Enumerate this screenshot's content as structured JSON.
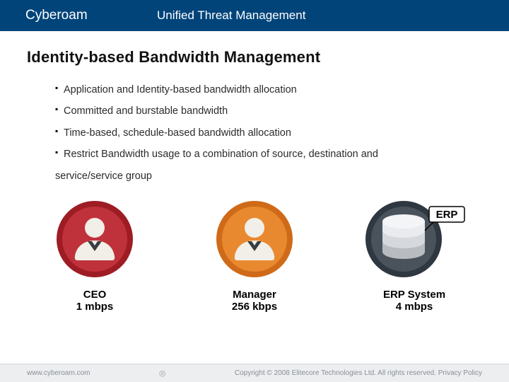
{
  "header": {
    "brand": "Cyberoam",
    "tagline": "Unified Threat Management"
  },
  "slide": {
    "title": "Identity-based Bandwidth Management",
    "bullets": [
      "Application and Identity-based bandwidth allocation",
      "Committed and burstable bandwidth",
      "Time-based, schedule-based bandwidth allocation",
      "Restrict Bandwidth usage to a combination of source, destination and",
      "service/service group"
    ]
  },
  "roles": [
    {
      "name": "CEO",
      "bandwidth": "1 mbps",
      "icon": "person-red",
      "badge": ""
    },
    {
      "name": "Manager",
      "bandwidth": "256 kbps",
      "icon": "person-orange",
      "badge": ""
    },
    {
      "name": "ERP System",
      "bandwidth": "4 mbps",
      "icon": "server",
      "badge": "ERP"
    }
  ],
  "colors": {
    "header_bg": "#00447a",
    "person_red_ring": "#9e1c24",
    "person_orange_ring": "#e07a1f",
    "server_ring": "#2f3740"
  },
  "footer": {
    "url": "www.cyberoam.com",
    "center_glyph": "◎",
    "copyright": "Copyright © 2008 Elitecore Technologies Ltd. All rights reserved. Privacy Policy"
  }
}
